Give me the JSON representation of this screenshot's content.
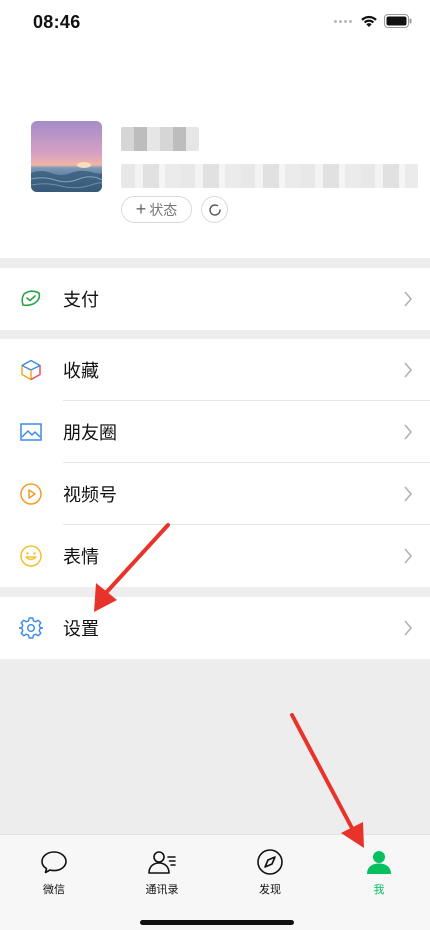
{
  "status_bar": {
    "time": "08:46"
  },
  "profile": {
    "status_button_label": "状态"
  },
  "menu": {
    "pay": {
      "label": "支付",
      "icon": "wallet-check-icon"
    },
    "favorites": {
      "label": "收藏",
      "icon": "cube-icon"
    },
    "moments": {
      "label": "朋友圈",
      "icon": "image-icon"
    },
    "channels": {
      "label": "视频号",
      "icon": "play-circle-icon"
    },
    "stickers": {
      "label": "表情",
      "icon": "smile-icon"
    },
    "settings": {
      "label": "设置",
      "icon": "gear-icon"
    }
  },
  "tabbar": {
    "tabs": [
      {
        "label": "微信",
        "icon": "chat-bubble-icon",
        "active": false
      },
      {
        "label": "通讯录",
        "icon": "contacts-icon",
        "active": false
      },
      {
        "label": "发现",
        "icon": "compass-icon",
        "active": false
      },
      {
        "label": "我",
        "icon": "person-icon",
        "active": true
      }
    ]
  },
  "colors": {
    "accent_green": "#07c160",
    "annotation_red": "#e8332a",
    "background": "#ededed"
  }
}
